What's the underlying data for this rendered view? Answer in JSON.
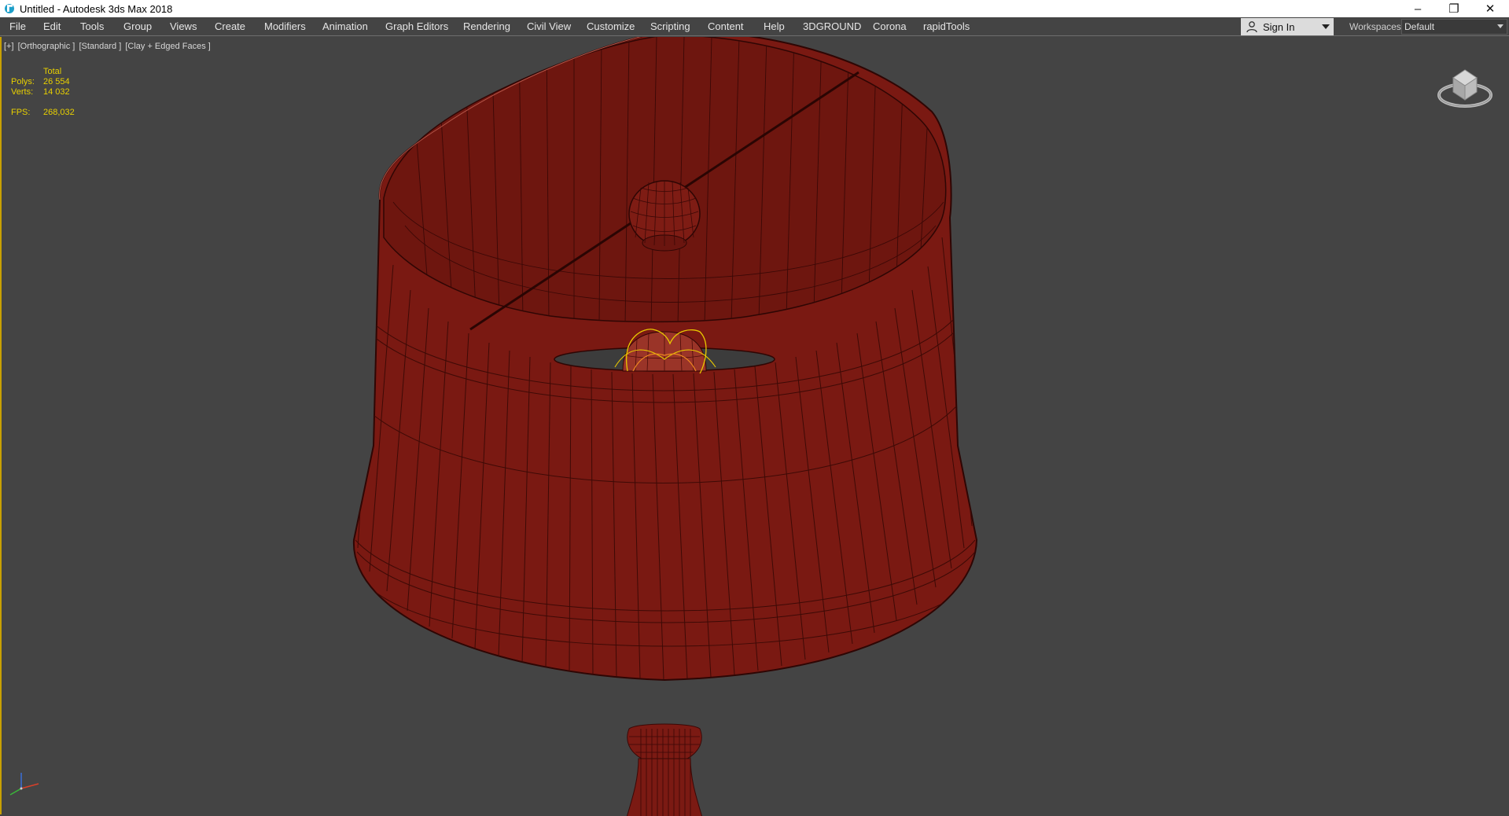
{
  "window": {
    "title": "Untitled - Autodesk 3ds Max 2018",
    "controls": {
      "minimize": "–",
      "restore": "❐",
      "close": "✕"
    }
  },
  "menu": {
    "items": [
      "File",
      "Edit",
      "Tools",
      "Group",
      "Views",
      "Create",
      "Modifiers",
      "Animation",
      "Graph Editors",
      "Rendering",
      "Civil View",
      "Customize",
      "Scripting",
      "Content",
      "Help",
      "3DGROUND",
      "Corona",
      "rapidTools"
    ]
  },
  "signin": {
    "label": "Sign In",
    "icon": "user-icon"
  },
  "workspaces": {
    "label": "Workspaces:",
    "value": "Default"
  },
  "viewport": {
    "label_parts": [
      "[+]",
      "[Orthographic ]",
      "[Standard ]",
      "[Clay + Edged Faces ]"
    ],
    "stats": {
      "total_label": "Total",
      "polys_label": "Polys:",
      "polys_value": "26 554",
      "verts_label": "Verts:",
      "verts_value": "14 032",
      "fps_label": "FPS:",
      "fps_value": "268,032"
    }
  },
  "colors": {
    "background": "#444444",
    "model": "#7b1a13",
    "wire": "#3a0806",
    "stats_text": "#e8d000",
    "viewport_border": "#c8a000"
  }
}
